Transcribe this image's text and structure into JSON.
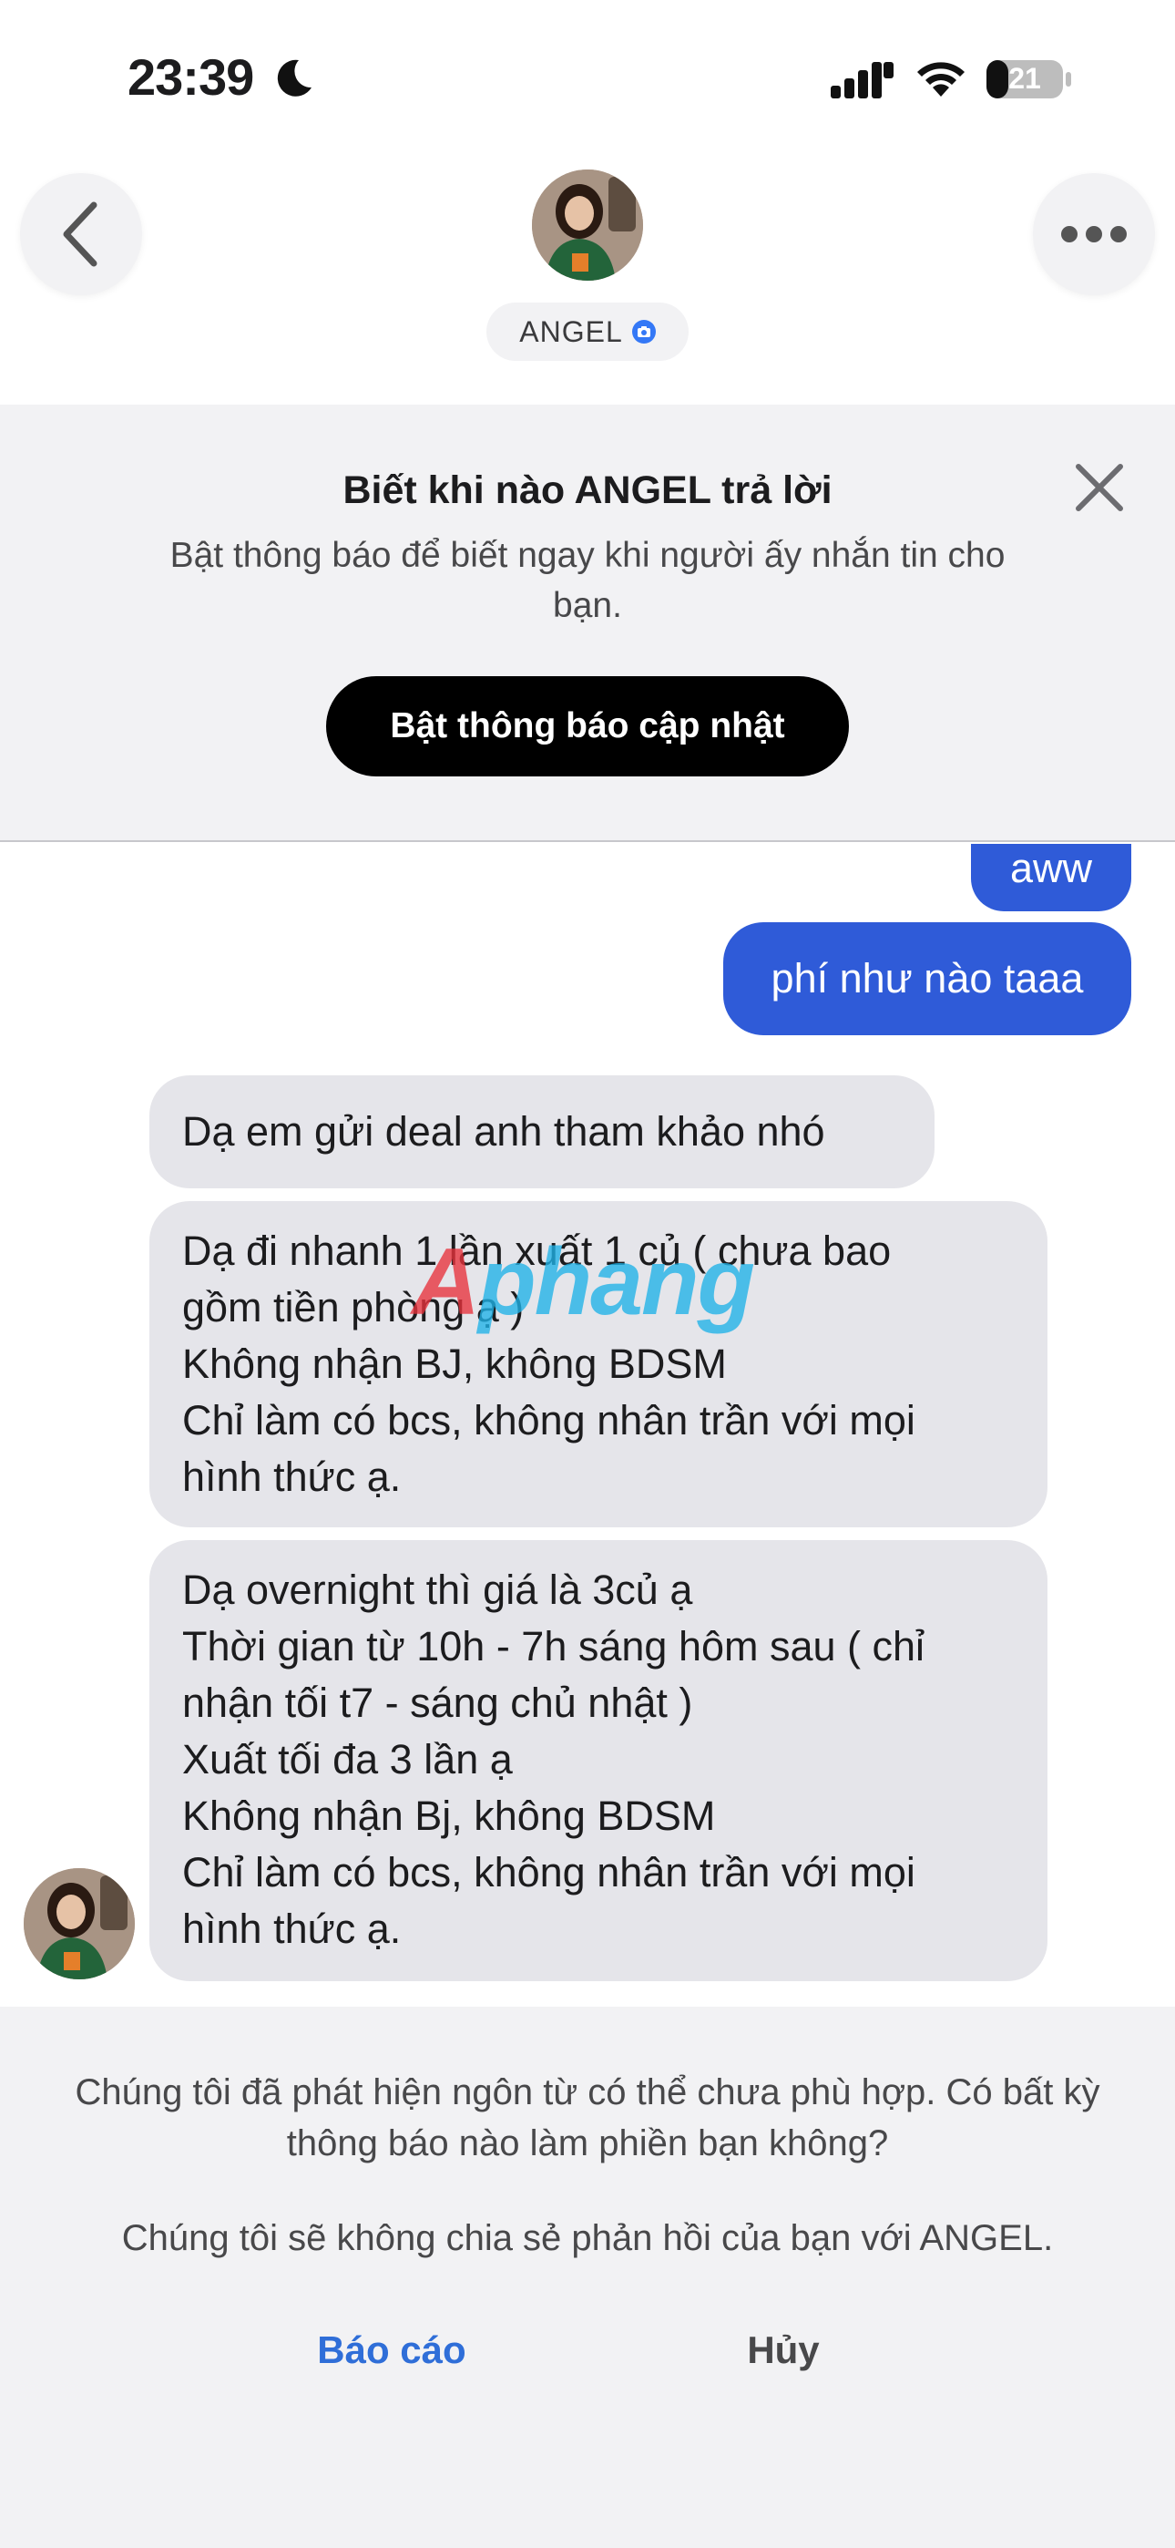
{
  "status_bar": {
    "time": "23:39",
    "battery_level": "21"
  },
  "header": {
    "contact_name": "ANGEL",
    "back_icon": "chevron-left-icon",
    "more_icon": "ellipsis-icon"
  },
  "banner": {
    "title": "Biết khi nào ANGEL trả lời",
    "subtitle": "Bật thông báo để biết ngay khi người ấy nhắn tin cho bạn.",
    "button_label": "Bật thông báo cập nhật"
  },
  "messages": {
    "out_1": "aww",
    "out_2": "phí như nào taaa",
    "in_1": "Dạ em gửi deal anh tham khảo nhó",
    "in_2": [
      "Dạ đi nhanh 1 lần xuất 1 củ ( chưa bao",
      "gồm tiền phòng ạ )",
      "Không nhận BJ, không BDSM",
      "Chỉ làm có bcs, không nhân trần với mọi",
      "hình thức ạ."
    ],
    "in_3": [
      "Dạ overnight thì giá là 3củ ạ",
      "Thời gian từ 10h - 7h sáng hôm sau ( chỉ",
      "nhận tối t7 - sáng chủ nhật )",
      "Xuất tối đa 3 lần ạ",
      "Không nhận Bj, không BDSM",
      "Chỉ làm có bcs, không nhân trần với mọi",
      "hình thức ạ."
    ]
  },
  "watermark": {
    "first": "A",
    "rest": "phang"
  },
  "feedback": {
    "question": "Chúng tôi đã phát hiện ngôn từ có thể chưa phù hợp. Có bất kỳ thông báo nào làm phiền bạn không?",
    "privacy_note": "Chúng tôi sẽ không chia sẻ phản hồi của bạn với ANGEL.",
    "report_label": "Báo cáo",
    "cancel_label": "Hủy"
  },
  "colors": {
    "outgoing_bubble": "#2f5bd8",
    "incoming_bubble": "#e5e5ea",
    "link_blue": "#2f6ed8"
  }
}
